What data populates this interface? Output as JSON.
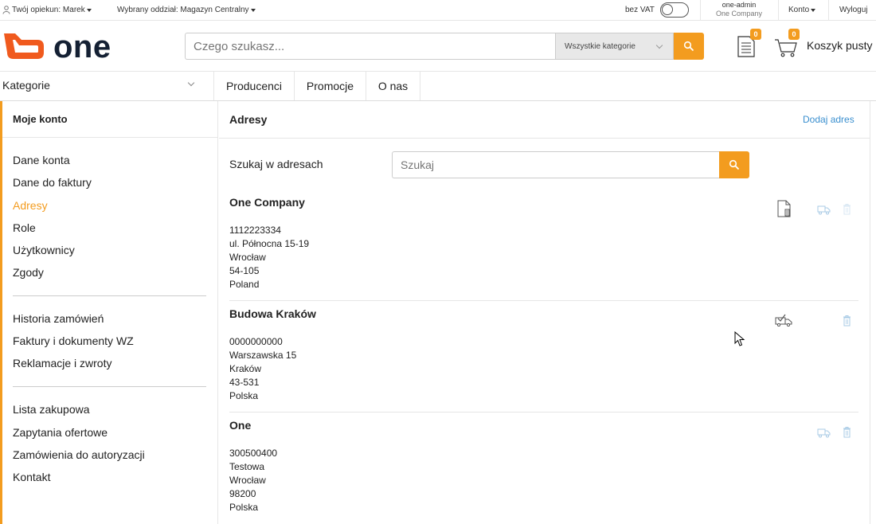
{
  "topbar": {
    "guardian": "Twój opiekun: Marek",
    "branch": "Wybrany oddział: Magazyn Centralny",
    "vat_label": "bez VAT",
    "vat_toggle_on": false,
    "user": "one-admin",
    "company": "One Company",
    "account": "Konto",
    "logout": "Wyloguj"
  },
  "header": {
    "logo_text": "one",
    "search_placeholder": "Czego szukasz...",
    "category_select": "Wszystkie kategorie",
    "documents_count": "0",
    "cart_count": "0",
    "cart_label": "Koszyk pusty"
  },
  "nav": {
    "categories": "Kategorie",
    "items": [
      "Producenci",
      "Promocje",
      "O nas"
    ]
  },
  "sidebar": {
    "title": "Moje konto",
    "group1": [
      "Dane konta",
      "Dane do faktury",
      "Adresy",
      "Role",
      "Użytkownicy",
      "Zgody"
    ],
    "group2": [
      "Historia zamówień",
      "Faktury i dokumenty WZ",
      "Reklamacje i zwroty"
    ],
    "group3": [
      "Lista zakupowa",
      "Zapytania ofertowe",
      "Zamówienia do autoryzacji",
      "Kontakt"
    ],
    "active": "Adresy"
  },
  "main": {
    "title": "Adresy",
    "add_address": "Dodaj adres",
    "search_label": "Szukaj w adresach",
    "search_placeholder": "Szukaj"
  },
  "addresses": [
    {
      "name": "One Company",
      "lines": [
        "1112223334",
        "ul. Północna 15-19",
        "Wrocław",
        "54-105",
        "Poland"
      ],
      "is_invoice": true,
      "is_delivery_default": false
    },
    {
      "name": "Budowa Kraków",
      "lines": [
        "0000000000",
        "Warszawska 15",
        "Kraków",
        "43-531",
        "Polska"
      ],
      "is_invoice": false,
      "is_delivery_default": true
    },
    {
      "name": "One",
      "lines": [
        "300500400",
        "Testowa",
        "Wrocław",
        "98200",
        "Polska"
      ],
      "is_invoice": false,
      "is_delivery_default": false
    }
  ],
  "colors": {
    "accent": "#f39c1f",
    "link": "#3a8fcf",
    "icon_light": "#a9cbe6"
  }
}
